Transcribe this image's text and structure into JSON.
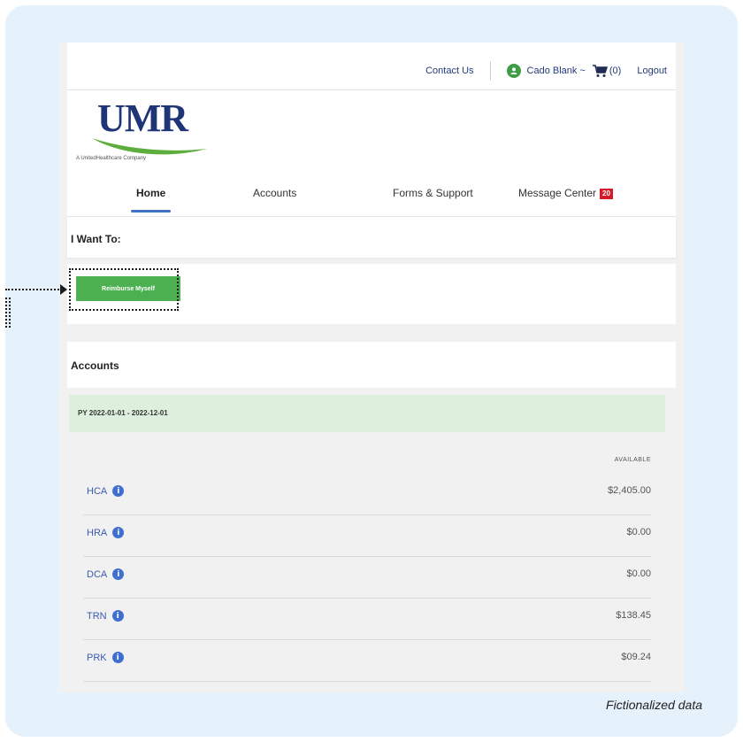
{
  "header": {
    "contact_label": "Contact Us",
    "user_label": "Cado Blank ~",
    "cart_count": "(0)",
    "logout_label": "Logout"
  },
  "logo": {
    "text": "UMR",
    "tagline": "A UnitedHealthcare Company"
  },
  "nav": {
    "items": [
      {
        "label": "Home"
      },
      {
        "label": "Accounts"
      },
      {
        "label": "Forms & Support"
      },
      {
        "label": "Message Center"
      }
    ],
    "active": "Home",
    "message_badge": "20"
  },
  "want": {
    "title": "I Want To:",
    "reimburse_label": "Reimburse Myself"
  },
  "accounts": {
    "title": "Accounts",
    "plan_year": "PY 2022-01-01 - 2022-12-01",
    "column_header": "AVAILABLE",
    "rows": [
      {
        "name": "HCA",
        "available": "$2,405.00"
      },
      {
        "name": "HRA",
        "available": "$0.00"
      },
      {
        "name": "DCA",
        "available": "$0.00"
      },
      {
        "name": "TRN",
        "available": "$138.45"
      },
      {
        "name": "PRK",
        "available": "$09.24"
      }
    ]
  },
  "footnote": "Fictionalized data",
  "colors": {
    "brand_navy": "#1f3577",
    "brand_green": "#4caf50",
    "link_blue": "#3a5bb0",
    "badge_red": "#d51a2a",
    "plan_header_bg": "#ddf0dd",
    "frame_bg": "#e5f1fb"
  }
}
